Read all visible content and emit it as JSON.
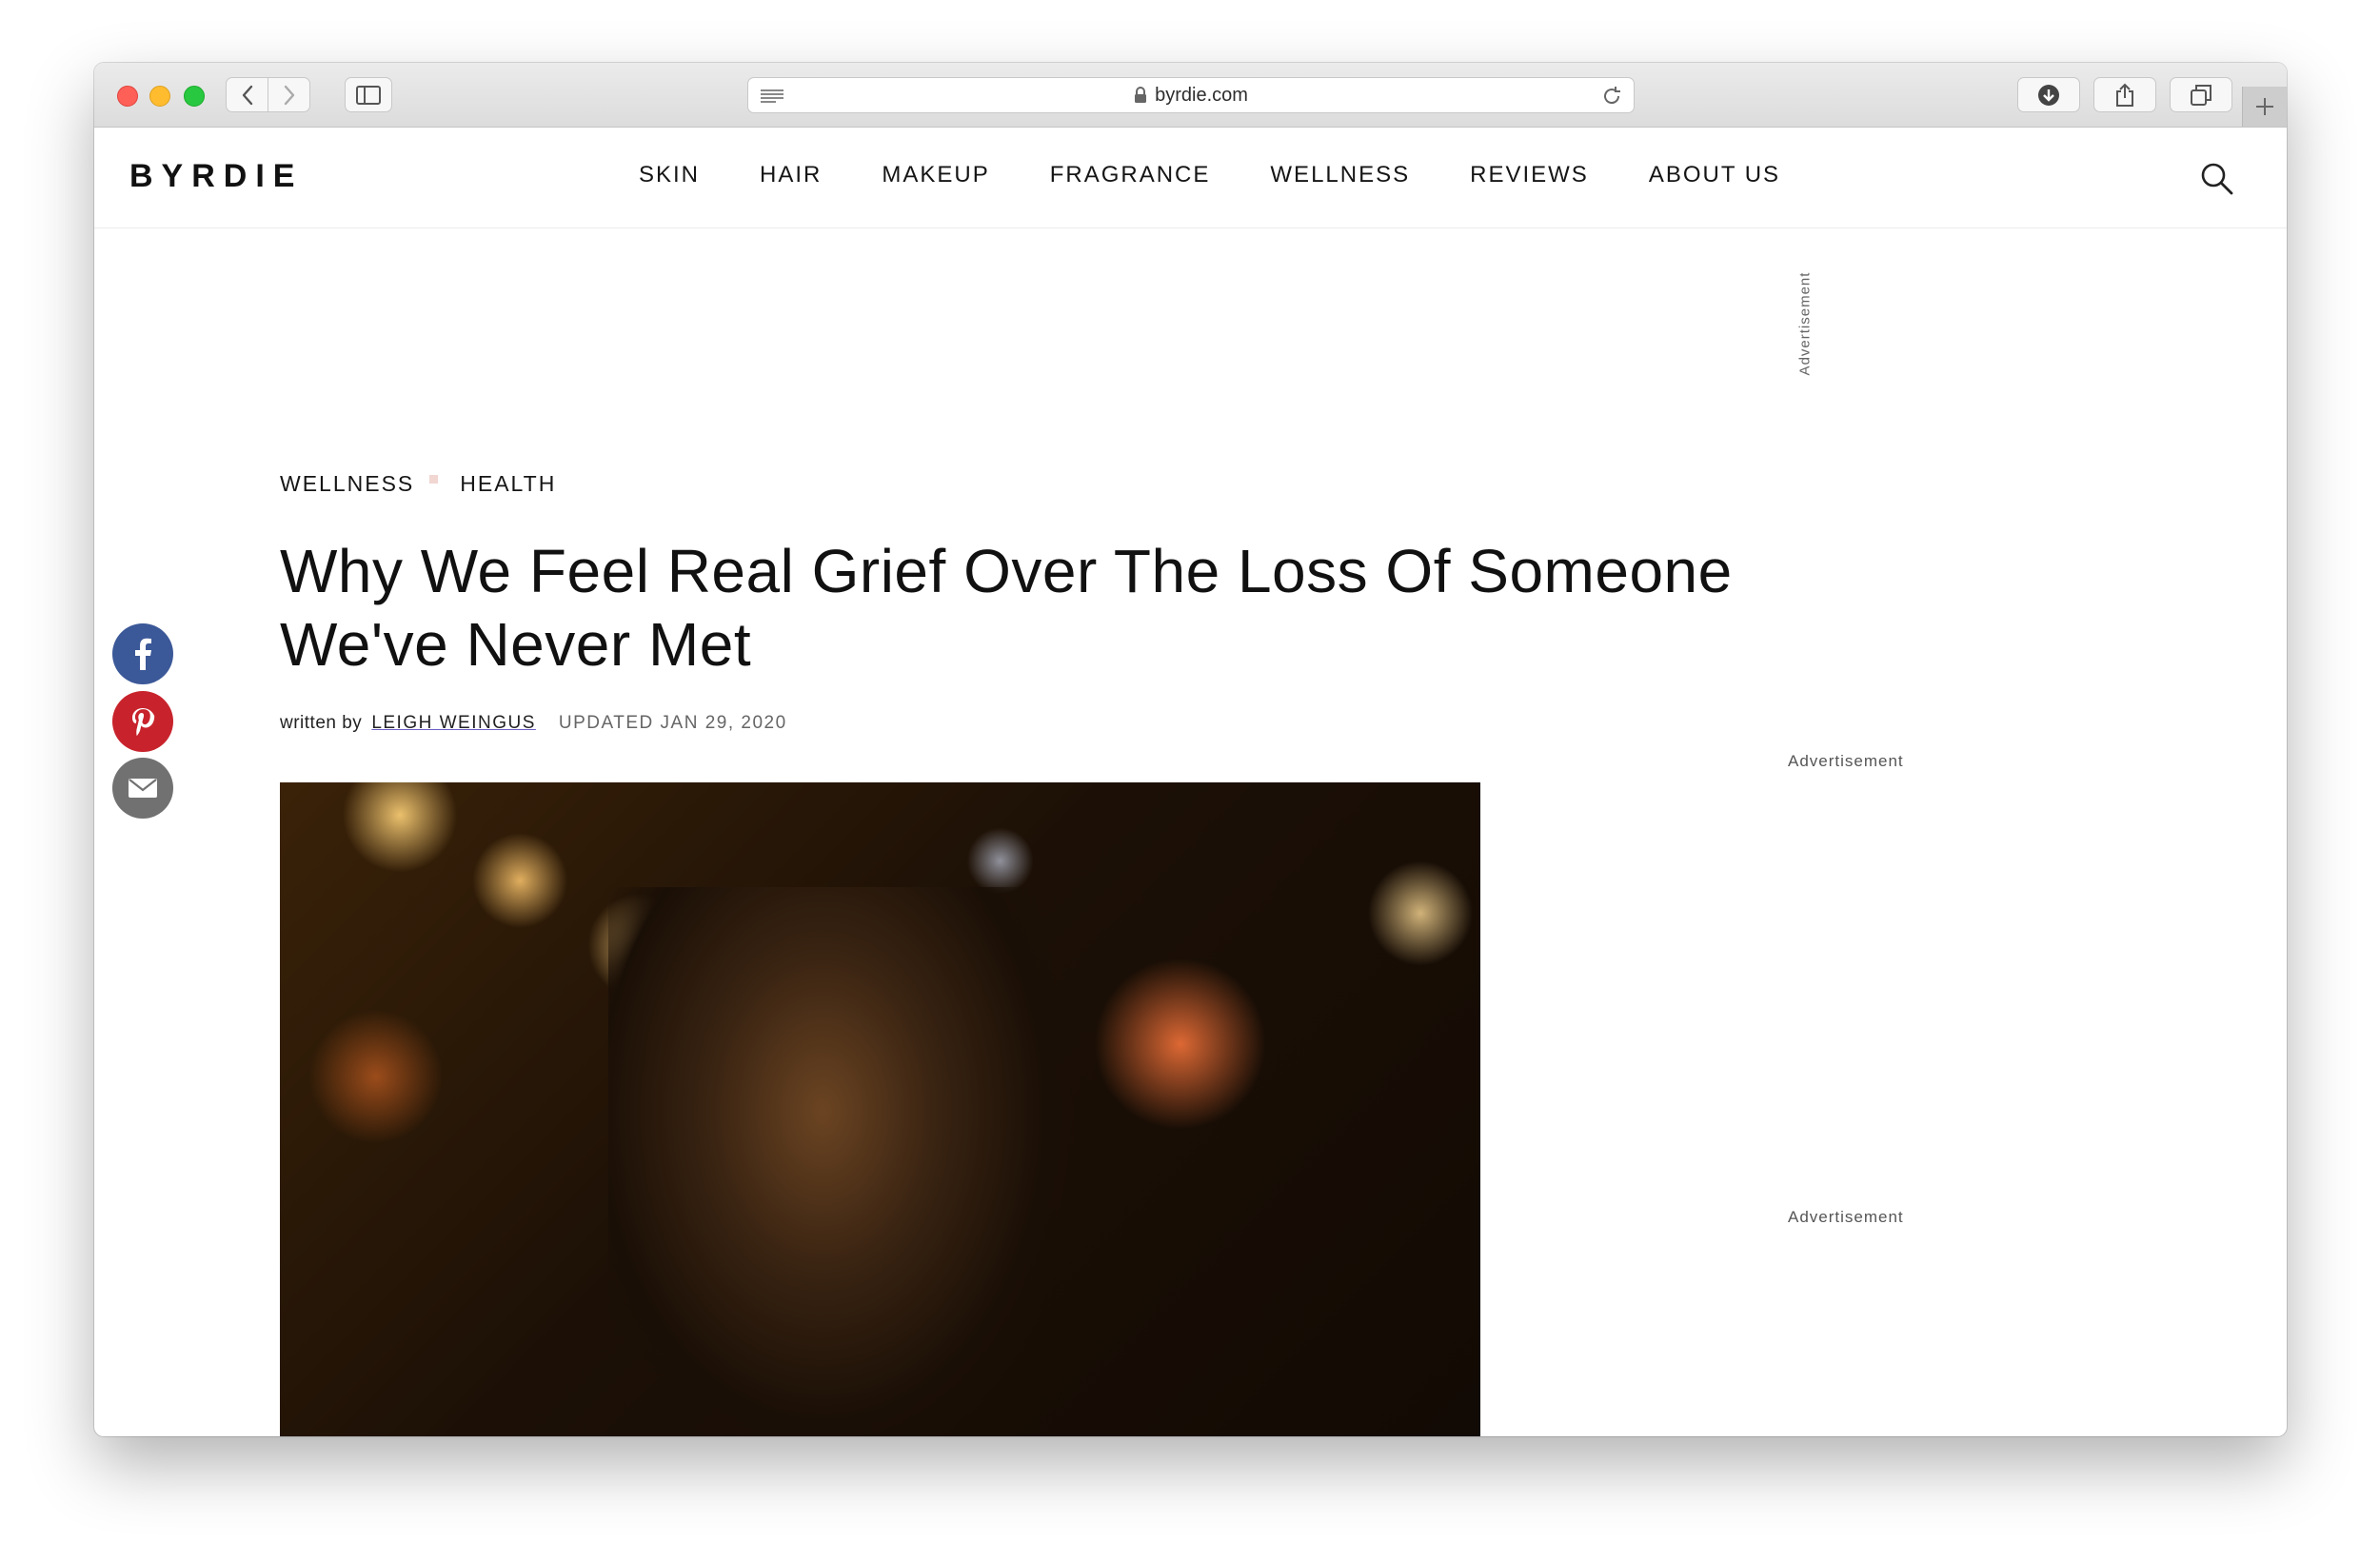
{
  "browser": {
    "url": "byrdie.com"
  },
  "site": {
    "logo": "BYRDIE",
    "nav": [
      {
        "label": "SKIN"
      },
      {
        "label": "HAIR"
      },
      {
        "label": "MAKEUP"
      },
      {
        "label": "FRAGRANCE"
      },
      {
        "label": "WELLNESS"
      },
      {
        "label": "REVIEWS"
      },
      {
        "label": "ABOUT US"
      }
    ]
  },
  "article": {
    "breadcrumb": [
      "WELLNESS",
      "HEALTH"
    ],
    "title": "Why We Feel Real Grief Over The Loss Of Someone We've Never Met",
    "byline_prefix": "written by",
    "author": "LEIGH WEINGUS",
    "updated": "UPDATED JAN 29, 2020"
  },
  "ads": {
    "top_label": "Advertisement",
    "side_label_1": "Advertisement",
    "side_label_2": "Advertisement"
  },
  "colors": {
    "facebook": "#3b5898",
    "pinterest": "#c8232c",
    "email": "#717171",
    "breadcrumb_separator": "#f1d6d2"
  },
  "icons": {
    "social": [
      "facebook-icon",
      "pinterest-icon",
      "email-icon"
    ],
    "header": [
      "search-icon"
    ],
    "toolbar": [
      "back-icon",
      "forward-icon",
      "sidebar-icon",
      "reader-icon",
      "lock-icon",
      "reload-icon",
      "download-icon",
      "share-icon",
      "tabs-icon",
      "plus-icon"
    ]
  }
}
